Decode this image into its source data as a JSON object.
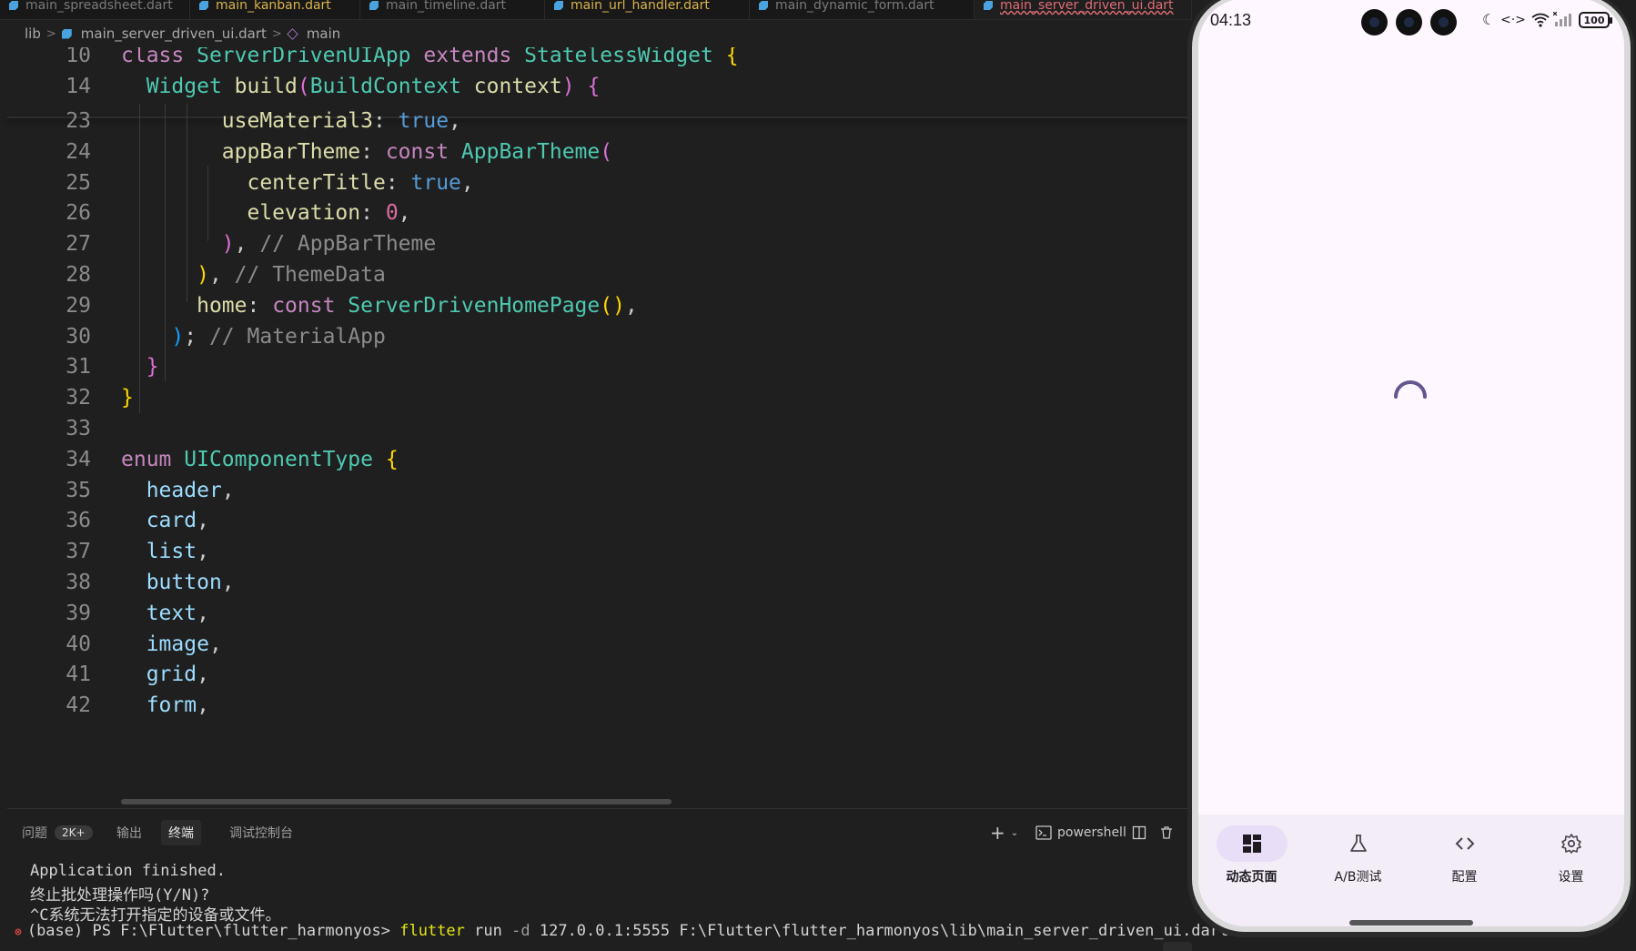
{
  "editor": {
    "tabs": [
      {
        "label": "main_spreadsheet.dart",
        "state": "normal"
      },
      {
        "label": "main_kanban.dart",
        "state": "modified"
      },
      {
        "label": "main_timeline.dart",
        "state": "normal"
      },
      {
        "label": "main_url_handler.dart",
        "state": "modified"
      },
      {
        "label": "main_dynamic_form.dart",
        "state": "normal"
      },
      {
        "label": "main_server_driven_ui.dart",
        "state": "active"
      }
    ],
    "breadcrumb": {
      "folder": "lib",
      "file": "main_server_driven_ui.dart",
      "symbol": "main"
    },
    "sticky_lines": [
      {
        "n": "10",
        "tokens": [
          [
            "kw",
            "class"
          ],
          [
            "pu",
            " "
          ],
          [
            "ty",
            "ServerDrivenUIApp"
          ],
          [
            "pu",
            " "
          ],
          [
            "kw",
            "extends"
          ],
          [
            "pu",
            " "
          ],
          [
            "ty",
            "StatelessWidget"
          ],
          [
            "pu",
            " "
          ],
          [
            "b1",
            "{"
          ]
        ]
      },
      {
        "n": "14",
        "tokens": [
          [
            "pu",
            "  "
          ],
          [
            "ty",
            "Widget"
          ],
          [
            "pu",
            " "
          ],
          [
            "fn",
            "build"
          ],
          [
            "b2",
            "("
          ],
          [
            "ty",
            "BuildContext"
          ],
          [
            "pu",
            " "
          ],
          [
            "pr",
            "context"
          ],
          [
            "b2",
            ")"
          ],
          [
            "pu",
            " "
          ],
          [
            "b2",
            "{"
          ]
        ]
      }
    ],
    "lines": [
      {
        "n": "23",
        "tokens": [
          [
            "pu",
            "        "
          ],
          [
            "pr",
            "useMaterial3"
          ],
          [
            "pu",
            ": "
          ],
          [
            "bo",
            "true"
          ],
          [
            "pu",
            ","
          ]
        ]
      },
      {
        "n": "24",
        "tokens": [
          [
            "pu",
            "        "
          ],
          [
            "pr",
            "appBarTheme"
          ],
          [
            "pu",
            ": "
          ],
          [
            "kw",
            "const"
          ],
          [
            "pu",
            " "
          ],
          [
            "ty",
            "AppBarTheme"
          ],
          [
            "b2",
            "("
          ]
        ]
      },
      {
        "n": "25",
        "tokens": [
          [
            "pu",
            "          "
          ],
          [
            "pr",
            "centerTitle"
          ],
          [
            "pu",
            ": "
          ],
          [
            "bo",
            "true"
          ],
          [
            "pu",
            ","
          ]
        ]
      },
      {
        "n": "26",
        "tokens": [
          [
            "pu",
            "          "
          ],
          [
            "pr",
            "elevation"
          ],
          [
            "pu",
            ": "
          ],
          [
            "nu",
            "0"
          ],
          [
            "pu",
            ","
          ]
        ]
      },
      {
        "n": "27",
        "tokens": [
          [
            "pu",
            "        "
          ],
          [
            "b2",
            ")"
          ],
          [
            "pu",
            ", "
          ],
          [
            "cm",
            "// AppBarTheme"
          ]
        ]
      },
      {
        "n": "28",
        "tokens": [
          [
            "pu",
            "      "
          ],
          [
            "b1",
            ")"
          ],
          [
            "pu",
            ", "
          ],
          [
            "cm",
            "// ThemeData"
          ]
        ]
      },
      {
        "n": "29",
        "tokens": [
          [
            "pu",
            "      "
          ],
          [
            "pr",
            "home"
          ],
          [
            "pu",
            ": "
          ],
          [
            "kw",
            "const"
          ],
          [
            "pu",
            " "
          ],
          [
            "ty",
            "ServerDrivenHomePage"
          ],
          [
            "b1",
            "()"
          ],
          [
            "pu",
            ","
          ]
        ]
      },
      {
        "n": "30",
        "tokens": [
          [
            "pu",
            "    "
          ],
          [
            "b3",
            ")"
          ],
          [
            "pu",
            "; "
          ],
          [
            "cm",
            "// MaterialApp"
          ]
        ]
      },
      {
        "n": "31",
        "tokens": [
          [
            "pu",
            "  "
          ],
          [
            "b2",
            "}"
          ]
        ]
      },
      {
        "n": "32",
        "tokens": [
          [
            "b1",
            "}"
          ]
        ]
      },
      {
        "n": "33",
        "tokens": []
      },
      {
        "n": "34",
        "tokens": [
          [
            "kw",
            "enum"
          ],
          [
            "pu",
            " "
          ],
          [
            "ty",
            "UIComponentType"
          ],
          [
            "pu",
            " "
          ],
          [
            "b1",
            "{"
          ]
        ]
      },
      {
        "n": "35",
        "tokens": [
          [
            "pu",
            "  "
          ],
          [
            "en",
            "header"
          ],
          [
            "pu",
            ","
          ]
        ]
      },
      {
        "n": "36",
        "tokens": [
          [
            "pu",
            "  "
          ],
          [
            "en",
            "card"
          ],
          [
            "pu",
            ","
          ]
        ]
      },
      {
        "n": "37",
        "tokens": [
          [
            "pu",
            "  "
          ],
          [
            "en",
            "list"
          ],
          [
            "pu",
            ","
          ]
        ]
      },
      {
        "n": "38",
        "tokens": [
          [
            "pu",
            "  "
          ],
          [
            "en",
            "button"
          ],
          [
            "pu",
            ","
          ]
        ]
      },
      {
        "n": "39",
        "tokens": [
          [
            "pu",
            "  "
          ],
          [
            "en",
            "text"
          ],
          [
            "pu",
            ","
          ]
        ]
      },
      {
        "n": "40",
        "tokens": [
          [
            "pu",
            "  "
          ],
          [
            "en",
            "image"
          ],
          [
            "pu",
            ","
          ]
        ]
      },
      {
        "n": "41",
        "tokens": [
          [
            "pu",
            "  "
          ],
          [
            "en",
            "grid"
          ],
          [
            "pu",
            ","
          ]
        ]
      },
      {
        "n": "42",
        "tokens": [
          [
            "pu",
            "  "
          ],
          [
            "en",
            "form"
          ],
          [
            "pu",
            ","
          ]
        ]
      }
    ]
  },
  "panel": {
    "tabs": [
      {
        "label": "问题",
        "badge": "2K+"
      },
      {
        "label": "输出"
      },
      {
        "label": "终端",
        "active": true
      },
      {
        "label": "调试控制台"
      }
    ],
    "add_label": "+",
    "shell_label": "powershell",
    "terminal": {
      "line1": "Application finished.",
      "line2": "终止批处理操作吗(Y/N)?",
      "line3": "^C系统无法打开指定的设备或文件。",
      "prompt": "(base) PS F:\\Flutter\\flutter_harmonyos>",
      "cmd": "flutter",
      "arg1": "run",
      "flag": "-d",
      "rest": "127.0.0.1:5555 F:\\Flutter\\flutter_harmonyos\\lib\\main_server_driven_ui.dart"
    }
  },
  "phone": {
    "time": "04:13",
    "battery": "100",
    "spinner_color": "#65558f",
    "nav": [
      {
        "label": "动态页面",
        "icon": "dashboard-icon",
        "active": true
      },
      {
        "label": "A/B测试",
        "icon": "flask-icon"
      },
      {
        "label": "配置",
        "icon": "code-icon"
      },
      {
        "label": "设置",
        "icon": "gear-icon"
      }
    ]
  }
}
